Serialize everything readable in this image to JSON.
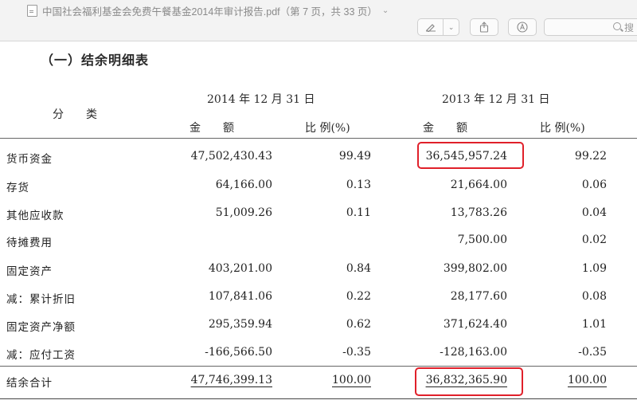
{
  "window": {
    "doc_title": "中国社会福利基金会免费午餐基金2014年审计报告.pdf（第 7 页，共 33 页）",
    "toolbar": {
      "annotate_icon": "pen-icon",
      "dropdown_icon": "chevron-down-icon",
      "share_icon": "share-icon",
      "markup_icon": "markup-circle-icon",
      "search_placeholder": "搜"
    }
  },
  "section_title": "（一）结余明细表",
  "table": {
    "category_header": "分　　类",
    "period_2014": "2014 年 12 月 31 日",
    "period_2013": "2013 年 12 月 31 日",
    "amount_header": "金　　额",
    "ratio_header": "比 例(%)",
    "rows": [
      {
        "label": "货币资金",
        "amt2014": "47,502,430.43",
        "pct2014": "99.49",
        "amt2013": "36,545,957.24",
        "pct2013": "99.22"
      },
      {
        "label": "存货",
        "amt2014": "64,166.00",
        "pct2014": "0.13",
        "amt2013": "21,664.00",
        "pct2013": "0.06"
      },
      {
        "label": "其他应收款",
        "amt2014": "51,009.26",
        "pct2014": "0.11",
        "amt2013": "13,783.26",
        "pct2013": "0.04"
      },
      {
        "label": "待摊费用",
        "amt2014": "",
        "pct2014": "",
        "amt2013": "7,500.00",
        "pct2013": "0.02"
      },
      {
        "label": "固定资产",
        "amt2014": "403,201.00",
        "pct2014": "0.84",
        "amt2013": "399,802.00",
        "pct2013": "1.09"
      },
      {
        "label": "减：累计折旧",
        "amt2014": "107,841.06",
        "pct2014": "0.22",
        "amt2013": "28,177.60",
        "pct2013": "0.08"
      },
      {
        "label": "固定资产净额",
        "amt2014": "295,359.94",
        "pct2014": "0.62",
        "amt2013": "371,624.40",
        "pct2013": "1.01"
      },
      {
        "label": "减：应付工资",
        "amt2014": "-166,566.50",
        "pct2014": "-0.35",
        "amt2013": "-128,163.00",
        "pct2013": "-0.35"
      }
    ],
    "total": {
      "label": "结余合计",
      "amt2014": "47,746,399.13",
      "pct2014": "100.00",
      "amt2013": "36,832,365.90",
      "pct2013": "100.00"
    }
  },
  "colors": {
    "highlight": "#e0202a",
    "toolbar_bg": "#f3f3f3"
  }
}
